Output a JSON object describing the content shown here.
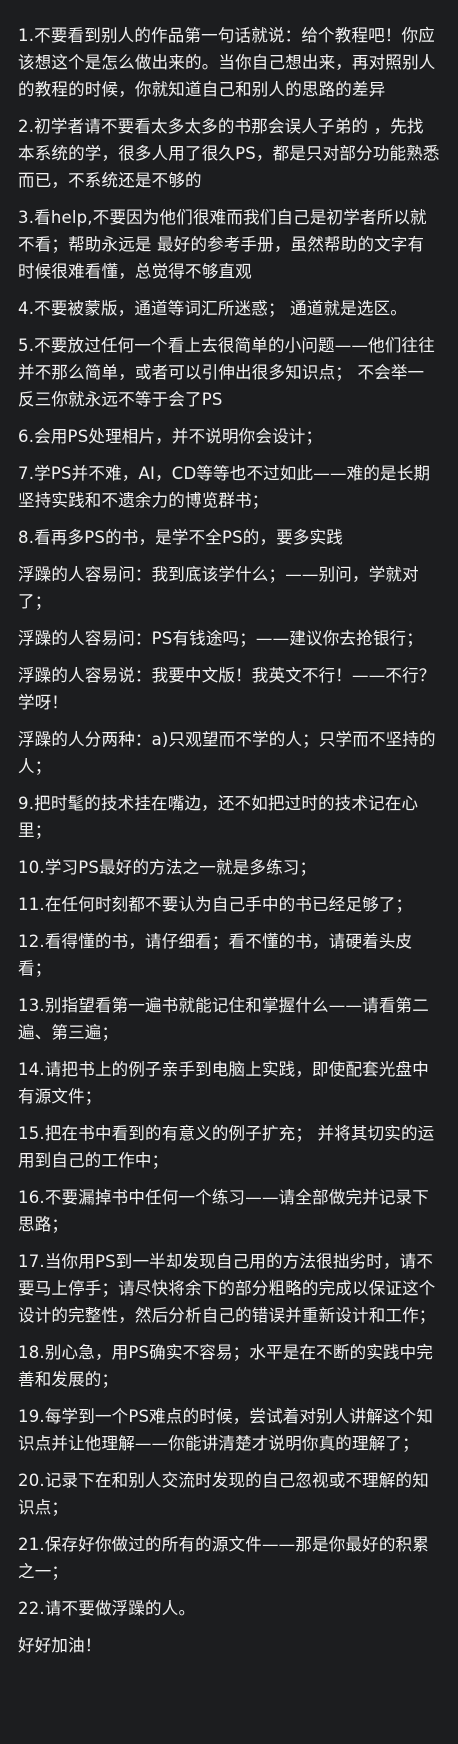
{
  "paragraphs": [
    "1.不要看到别人的作品第一句话就说：给个教程吧！你应该想这个是怎么做出来的。当你自己想出来，再对照别人的教程的时候，你就知道自己和别人的思路的差异",
    "2.初学者请不要看太多太多的书那会误人子弟的 ，先找本系统的学，很多人用了很久PS，都是只对部分功能熟悉而已，不系统还是不够的",
    "3.看help,不要因为他们很难而我们自己是初学者所以就不看；帮助永远是 最好的参考手册，虽然帮助的文字有时候很难看懂，总觉得不够直观",
    "4.不要被蒙版，通道等词汇所迷惑； 通道就是选区。",
    "5.不要放过任何一个看上去很简单的小问题——他们往往并不那么简单，或者可以引伸出很多知识点； 不会举一反三你就永远不等于会了PS",
    "6.会用PS处理相片，并不说明你会设计；",
    "7.学PS并不难，AI，CD等等也不过如此——难的是长期坚持实践和不遗余力的博览群书；",
    "8.看再多PS的书，是学不全PS的，要多实践",
    "浮躁的人容易问：我到底该学什么；——别问，学就对了；",
    "浮躁的人容易问：PS有钱途吗；——建议你去抢银行；",
    "浮躁的人容易说：我要中文版！我英文不行！——不行？学呀！",
    "浮躁的人分两种：a)只观望而不学的人；只学而不坚持的人；",
    "9.把时髦的技术挂在嘴边，还不如把过时的技术记在心里；",
    "10.学习PS最好的方法之一就是多练习；",
    "11.在任何时刻都不要认为自己手中的书已经足够了；",
    "12.看得懂的书，请仔细看；看不懂的书，请硬着头皮看；",
    "13.别指望看第一遍书就能记住和掌握什么——请看第二遍、第三遍；",
    "14.请把书上的例子亲手到电脑上实践，即使配套光盘中有源文件；",
    "15.把在书中看到的有意义的例子扩充； 并将其切实的运用到自己的工作中；",
    "16.不要漏掉书中任何一个练习——请全部做完并记录下思路；",
    "17.当你用PS到一半却发现自己用的方法很拙劣时，请不要马上停手；请尽快将余下的部分粗略的完成以保证这个设计的完整性，然后分析自己的错误并重新设计和工作；",
    "18.别心急，用PS确实不容易；水平是在不断的实践中完善和发展的；",
    "19.每学到一个PS难点的时候，尝试着对别人讲解这个知识点并让他理解——你能讲清楚才说明你真的理解了；",
    "20.记录下在和别人交流时发现的自己忽视或不理解的知识点；",
    "21.保存好你做过的所有的源文件——那是你最好的积累之一；",
    "22.请不要做浮躁的人。",
    "好好加油！"
  ]
}
